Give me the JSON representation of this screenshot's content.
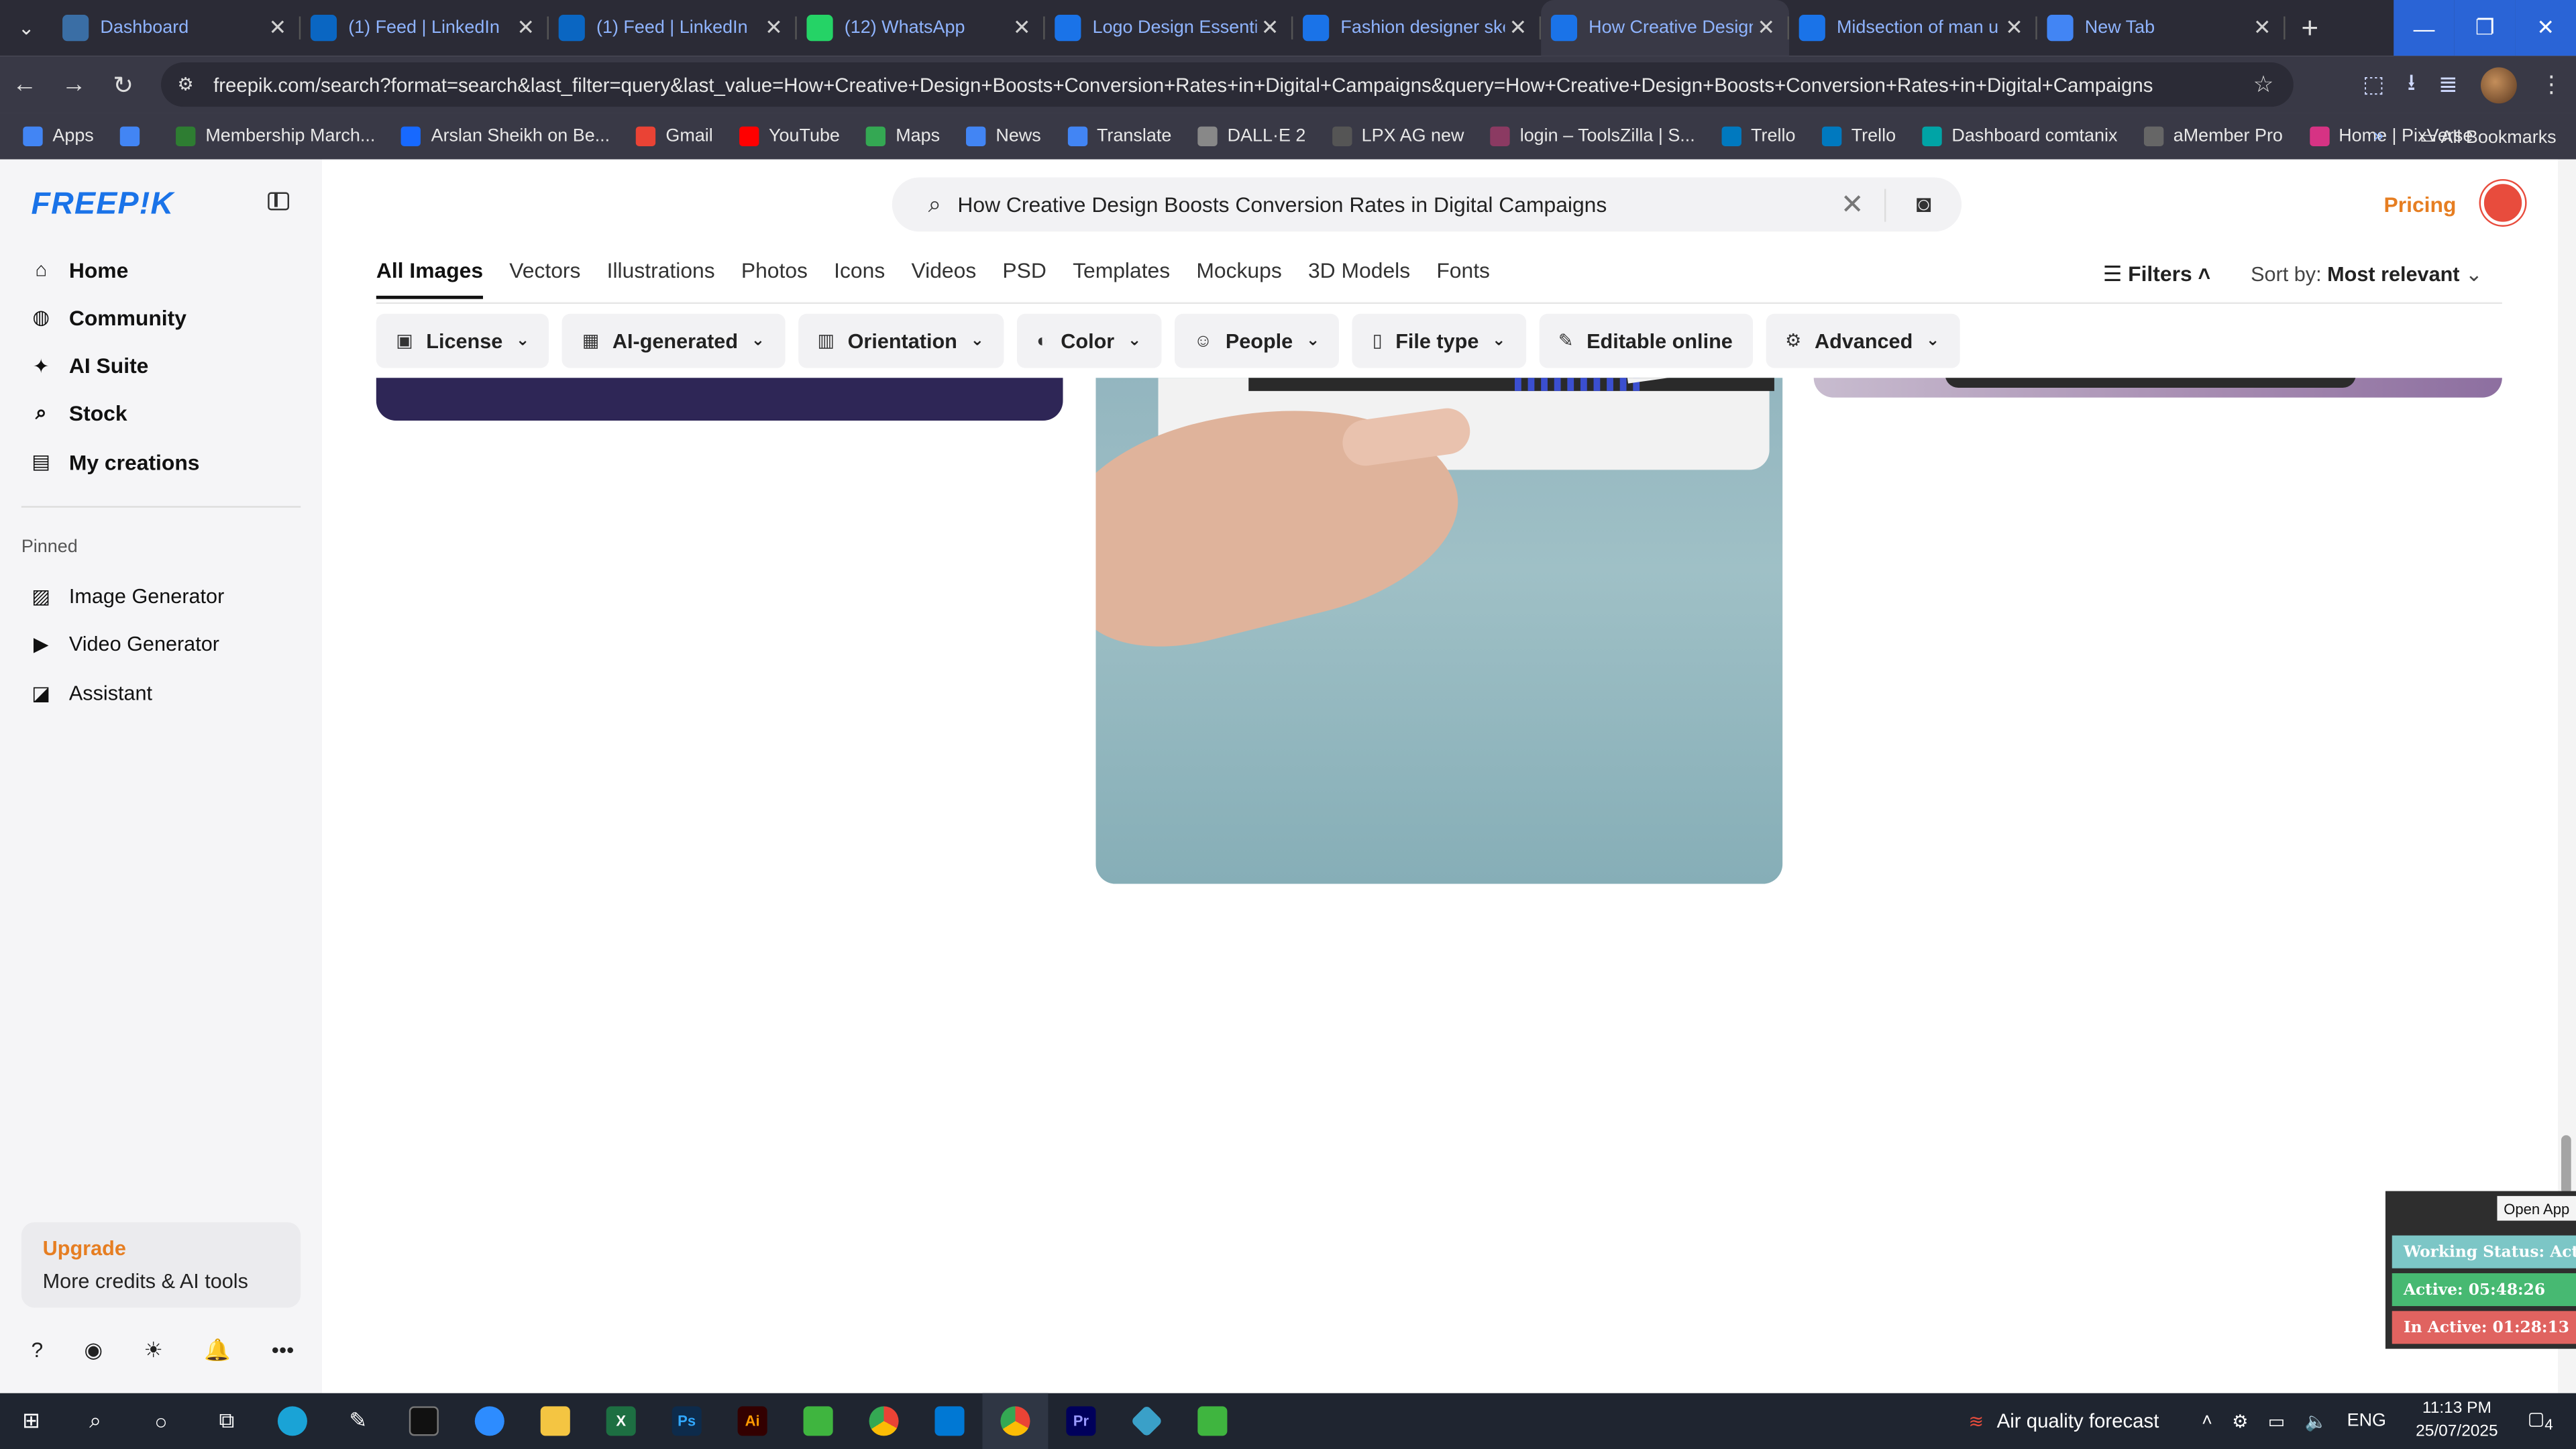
{
  "browser": {
    "tabs": [
      {
        "title": "Dashboard",
        "icon": "dashboard-icon",
        "color": "#3a6ea5"
      },
      {
        "title": "(1) Feed | LinkedIn",
        "icon": "linkedin-icon",
        "color": "#0a66c2"
      },
      {
        "title": "(1) Feed | LinkedIn",
        "icon": "linkedin-icon",
        "color": "#0a66c2"
      },
      {
        "title": "(12) WhatsApp",
        "icon": "whatsapp-icon",
        "color": "#25d366"
      },
      {
        "title": "Logo Design Essentia",
        "icon": "freepik-icon",
        "color": "#1a73e8"
      },
      {
        "title": "Fashion designer ske",
        "icon": "freepik-icon",
        "color": "#1a73e8"
      },
      {
        "title": "How Creative Design",
        "icon": "freepik-icon",
        "color": "#1a73e8"
      },
      {
        "title": "Midsection of man u",
        "icon": "freepik-icon",
        "color": "#1a73e8"
      },
      {
        "title": "New Tab",
        "icon": "chrome-icon",
        "color": "#4285f4"
      }
    ],
    "url": "freepik.com/search?format=search&last_filter=query&last_value=How+Creative+Design+Boosts+Conversion+Rates+in+Digital+Campaigns&query=How+Creative+Design+Boosts+Conversion+Rates+in+Digital+Campaigns",
    "bookmarks": [
      {
        "label": "Apps",
        "color": "#4285f4"
      },
      {
        "label": "",
        "color": "#4285f4"
      },
      {
        "label": "Membership March...",
        "color": "#2e7d32"
      },
      {
        "label": "Arslan Sheikh on Be...",
        "color": "#1769ff"
      },
      {
        "label": "Gmail",
        "color": "#ea4335"
      },
      {
        "label": "YouTube",
        "color": "#ff0000"
      },
      {
        "label": "Maps",
        "color": "#34a853"
      },
      {
        "label": "News",
        "color": "#4285f4"
      },
      {
        "label": "Translate",
        "color": "#4285f4"
      },
      {
        "label": "DALL·E 2",
        "color": "#888888"
      },
      {
        "label": "LPX AG new",
        "color": "#555555"
      },
      {
        "label": "login – ToolsZilla | S...",
        "color": "#8b3a62"
      },
      {
        "label": "Trello",
        "color": "#0079bf"
      },
      {
        "label": "Trello",
        "color": "#0079bf"
      },
      {
        "label": "Dashboard comtanix",
        "color": "#00a4a6"
      },
      {
        "label": "aMember Pro",
        "color": "#666666"
      },
      {
        "label": "Home | PixVerse",
        "color": "#d63384"
      }
    ],
    "all_bookmarks": "All Bookmarks"
  },
  "freepik": {
    "logo": "FREEP!K",
    "nav": [
      {
        "label": "Home",
        "icon": "home-icon"
      },
      {
        "label": "Community",
        "icon": "globe-icon"
      },
      {
        "label": "AI Suite",
        "icon": "sparkle-icon"
      },
      {
        "label": "Stock",
        "icon": "search-icon"
      },
      {
        "label": "My creations",
        "icon": "folder-icon"
      }
    ],
    "pinned_label": "Pinned",
    "pinned": [
      {
        "label": "Image Generator",
        "icon": "image-icon"
      },
      {
        "label": "Video Generator",
        "icon": "video-icon"
      },
      {
        "label": "Assistant",
        "icon": "assistant-icon"
      }
    ],
    "upgrade": {
      "title": "Upgrade",
      "subtitle": "More credits & AI tools"
    },
    "search_query": "How Creative Design Boosts Conversion Rates in Digital Campaigns",
    "pricing": "Pricing",
    "content_tabs": [
      "All Images",
      "Vectors",
      "Illustrations",
      "Photos",
      "Icons",
      "Videos",
      "PSD",
      "Templates",
      "Mockups",
      "3D Models",
      "Fonts"
    ],
    "filters_label": "Filters",
    "sort_prefix": "Sort by:",
    "sort_value": "Most relevant",
    "filter_chips": [
      {
        "label": "License",
        "icon": "license-icon"
      },
      {
        "label": "AI-generated",
        "icon": "ai-icon"
      },
      {
        "label": "Orientation",
        "icon": "orientation-icon"
      },
      {
        "label": "Color",
        "icon": "palette-icon"
      },
      {
        "label": "People",
        "icon": "people-icon"
      },
      {
        "label": "File type",
        "icon": "file-icon"
      },
      {
        "label": "Editable online",
        "icon": "pen-icon"
      },
      {
        "label": "Advanced",
        "icon": "gear-icon"
      }
    ]
  },
  "status_widget": {
    "open_app": "Open App",
    "working_status": "Working Status: Active",
    "active": "Active: 05:48:26",
    "inactive": "In Active: 01:28:13"
  },
  "taskbar": {
    "air_quality": "Air quality forecast",
    "lang": "ENG",
    "time": "11:13 PM",
    "date": "25/07/2025",
    "notif_count": "4"
  }
}
